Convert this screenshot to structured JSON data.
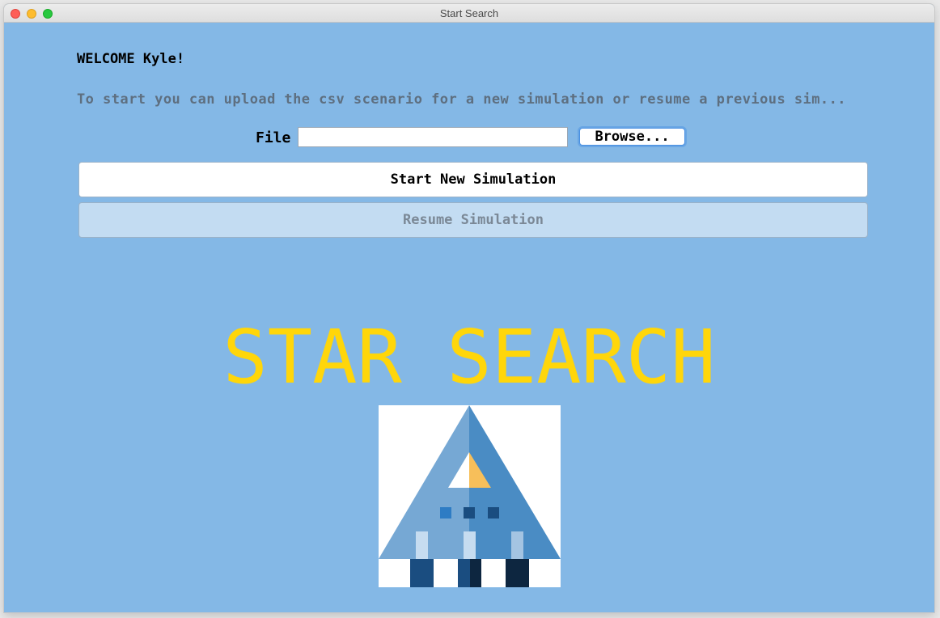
{
  "window": {
    "title": "Start Search"
  },
  "welcome": {
    "text": "WELCOME Kyle!"
  },
  "instructions": {
    "text": "To start you can upload the csv scenario for a new simulation or resume a previous sim..."
  },
  "file": {
    "label": "File",
    "value": "",
    "browse_label": "Browse..."
  },
  "actions": {
    "start_label": "Start New Simulation",
    "resume_label": "Resume Simulation",
    "resume_enabled": false
  },
  "hero": {
    "title": "STAR SEARCH"
  },
  "logo": {
    "icon": "pyramid-robot-logo"
  },
  "colors": {
    "background": "#84b8e6",
    "hero_title": "#ffd60a",
    "disabled_text": "#7b8896",
    "disabled_bg": "#c3dcf2"
  }
}
